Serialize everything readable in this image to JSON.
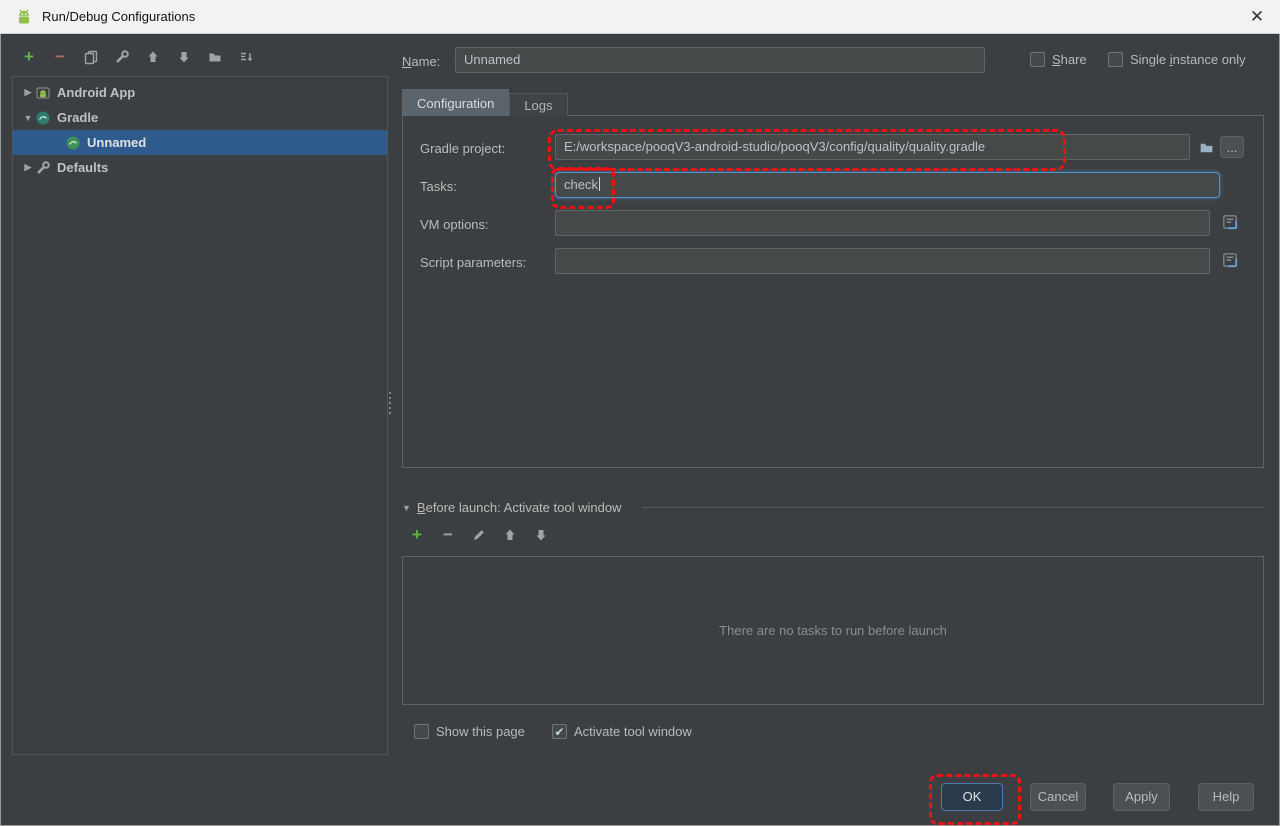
{
  "window": {
    "title": "Run/Debug Configurations"
  },
  "icons": {
    "close": "✕",
    "collapsed": "▶",
    "expanded": "▼",
    "checkmark": "✔",
    "ellipsis": "...",
    "plus": "+",
    "minus": "−"
  },
  "colors": {
    "selection": "#2e5a8c",
    "annotation": "#ea1212",
    "focus_border": "#4e94ce",
    "accent_green": "#62b543"
  },
  "sidebar": {
    "tree": [
      {
        "label": "Android App"
      },
      {
        "label": "Gradle"
      },
      {
        "label": "Unnamed"
      },
      {
        "label": "Defaults"
      }
    ]
  },
  "header": {
    "name_label": {
      "u": "N",
      "rest": "ame:"
    },
    "name_value": "Unnamed",
    "share": {
      "u": "S",
      "rest": "hare"
    },
    "single_instance": {
      "pre": "Single ",
      "u": "i",
      "rest": "nstance only"
    }
  },
  "tabs": {
    "configuration": "Configuration",
    "logs": "Logs"
  },
  "config": {
    "gradle_project_label": "Gradle project:",
    "gradle_project_value": "E:/workspace/pooqV3-android-studio/pooqV3/config/quality/quality.gradle",
    "tasks_label": "Tasks:",
    "tasks_value": "check",
    "vm_options_label": "VM options:",
    "vm_options_value": "",
    "script_parameters_label": "Script parameters:",
    "script_parameters_value": ""
  },
  "before_launch": {
    "title": {
      "u": "B",
      "rest": "efore launch: Activate tool window"
    },
    "empty_text": "There are no tasks to run before launch",
    "show_this_page": "Show this page",
    "activate_tool_window": "Activate tool window"
  },
  "footer": {
    "ok": "OK",
    "cancel": "Cancel",
    "apply": "Apply",
    "help": "Help"
  }
}
